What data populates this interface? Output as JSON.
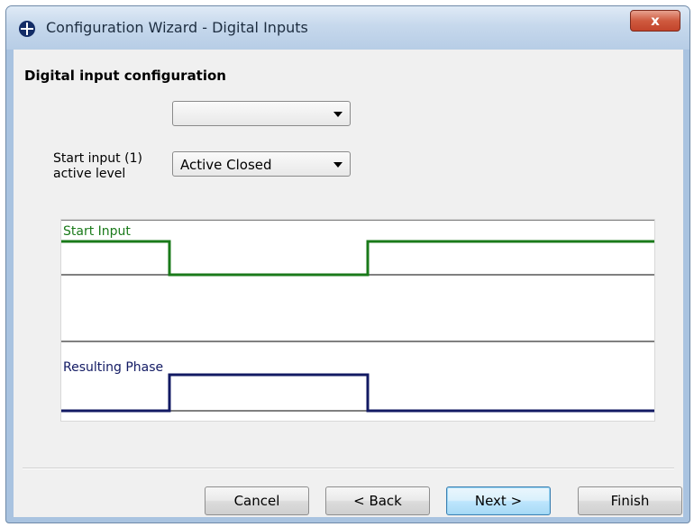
{
  "window": {
    "title": "Configuration Wizard - Digital Inputs",
    "icons": [
      "app-icon",
      "close-icon"
    ],
    "close_glyph": "x"
  },
  "form": {
    "heading": "Digital input configuration",
    "input_select": {
      "value": ""
    },
    "start_input_label": [
      "Start input (1)",
      "active level"
    ],
    "active_level_select": {
      "value": "Active Closed"
    }
  },
  "plot": {
    "start_trace_label": "Start Input",
    "phase_trace_label": "Resulting Phase",
    "colors": {
      "start": "#1a7a1a",
      "phase": "#121a63"
    }
  },
  "buttons": {
    "cancel": "Cancel",
    "back": "< Back",
    "next": "Next >",
    "finish": "Finish"
  }
}
